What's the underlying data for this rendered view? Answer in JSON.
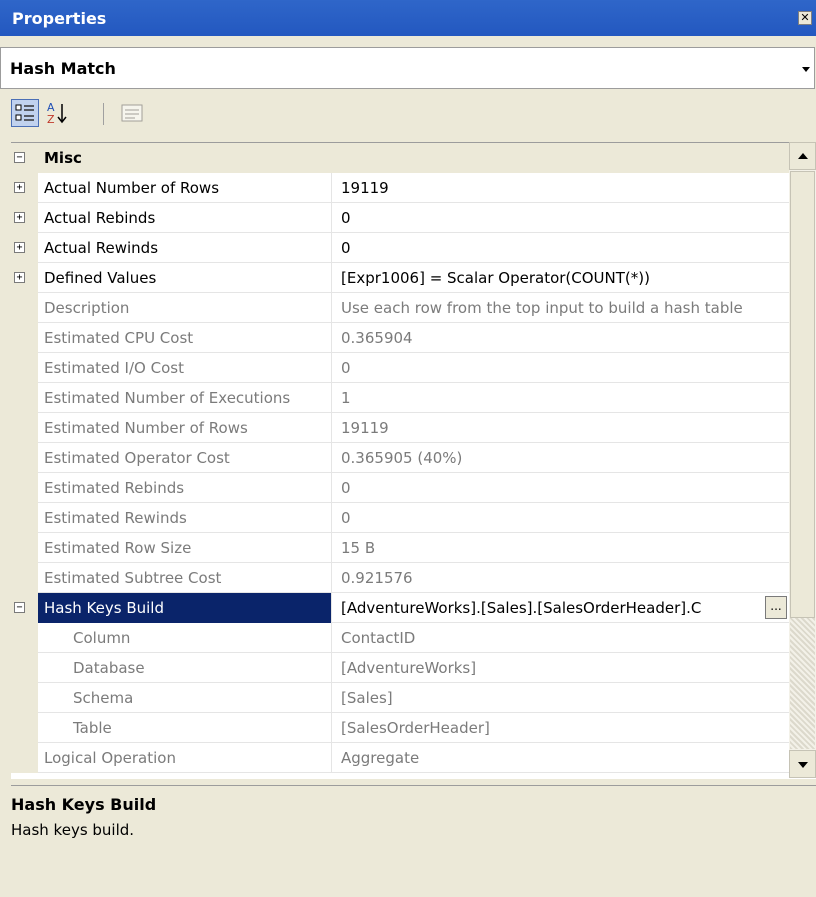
{
  "title": "Properties",
  "object_selector": {
    "value": "Hash Match"
  },
  "toolbar": {
    "categorized_icon": "categorized-icon",
    "alphabetical_icon": "alphabetical-sort-icon",
    "property_pages_icon": "property-pages-icon"
  },
  "grid": {
    "category": "Misc",
    "rows": [
      {
        "name": "Actual Number of Rows",
        "value": "19119",
        "expander": "+"
      },
      {
        "name": "Actual Rebinds",
        "value": "0",
        "expander": "+"
      },
      {
        "name": "Actual Rewinds",
        "value": "0",
        "expander": "+"
      },
      {
        "name": "Defined Values",
        "value": "[Expr1006] = Scalar Operator(COUNT(*))",
        "expander": "+"
      },
      {
        "name": "Description",
        "value": "Use each row from the top input to build a hash table",
        "expander": ""
      },
      {
        "name": "Estimated CPU Cost",
        "value": "0.365904",
        "expander": ""
      },
      {
        "name": "Estimated I/O Cost",
        "value": "0",
        "expander": ""
      },
      {
        "name": "Estimated Number of Executions",
        "value": "1",
        "expander": ""
      },
      {
        "name": "Estimated Number of Rows",
        "value": "19119",
        "expander": ""
      },
      {
        "name": "Estimated Operator Cost",
        "value": "0.365905 (40%)",
        "expander": ""
      },
      {
        "name": "Estimated Rebinds",
        "value": "0",
        "expander": ""
      },
      {
        "name": "Estimated Rewinds",
        "value": "0",
        "expander": ""
      },
      {
        "name": "Estimated Row Size",
        "value": "15 B",
        "expander": ""
      },
      {
        "name": "Estimated Subtree Cost",
        "value": "0.921576",
        "expander": ""
      },
      {
        "name": "Hash Keys Build",
        "value": "[AdventureWorks].[Sales].[SalesOrderHeader].C",
        "expander": "−",
        "ellipsis": "..."
      },
      {
        "name": "Column",
        "value": "ContactID",
        "expander": ""
      },
      {
        "name": "Database",
        "value": "[AdventureWorks]",
        "expander": ""
      },
      {
        "name": "Schema",
        "value": "[Sales]",
        "expander": ""
      },
      {
        "name": "Table",
        "value": "[SalesOrderHeader]",
        "expander": ""
      },
      {
        "name": "Logical Operation",
        "value": "Aggregate",
        "expander": ""
      }
    ]
  },
  "description": {
    "title": "Hash Keys Build",
    "text": "Hash keys build."
  },
  "colors": {
    "titlebar": "#2358c0",
    "selection": "#0a246a",
    "readonly_text": "#7b7b7b"
  }
}
